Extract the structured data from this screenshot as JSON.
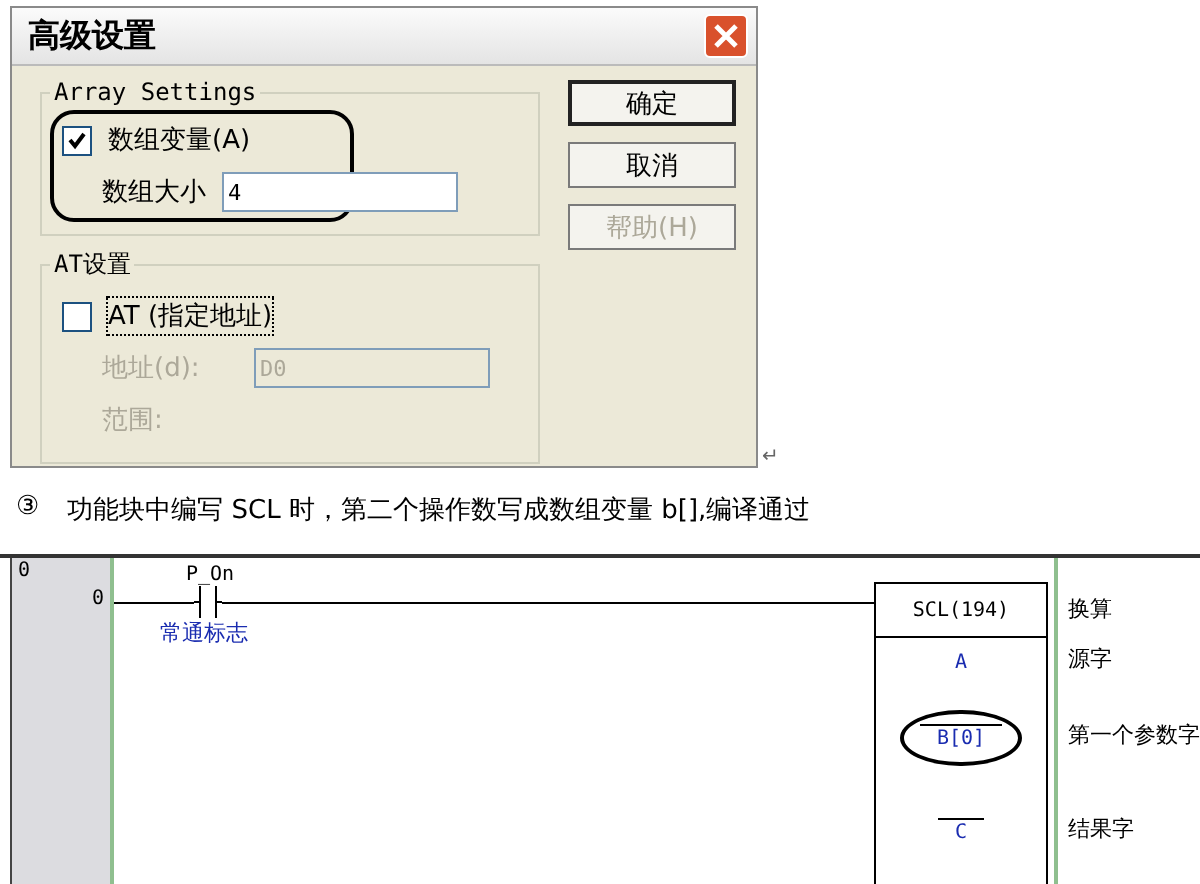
{
  "dialog": {
    "title": "高级设置",
    "groups": [
      {
        "title": "Array Settings",
        "circled": true,
        "rows": [
          {
            "kind": "checkbox",
            "label": "数组变量(A)",
            "checked": true,
            "disabled": false,
            "focused": false
          },
          {
            "kind": "field",
            "label": "数组大小",
            "value": "4",
            "disabled": false
          }
        ]
      },
      {
        "title": "AT设置",
        "circled": false,
        "rows": [
          {
            "kind": "checkbox",
            "label": "AT (指定地址)",
            "checked": false,
            "disabled": false,
            "focused": true
          },
          {
            "kind": "field",
            "label": "地址(d):",
            "value": "D0",
            "disabled": true
          },
          {
            "kind": "label",
            "label": "范围:",
            "disabled": true
          }
        ]
      }
    ],
    "buttons": [
      {
        "label": "确定",
        "disabled": false,
        "default": true
      },
      {
        "label": "取消",
        "disabled": false,
        "default": false
      },
      {
        "label": "帮助(H)",
        "disabled": true,
        "default": false
      }
    ]
  },
  "paragraph_mark": "↵",
  "caption": {
    "number": "③",
    "text": "功能块中编写 SCL 时，第二个操作数写成数组变量 b[],编译通过"
  },
  "ladder": {
    "rung": "0",
    "step": "0",
    "contact": {
      "name": "P_On",
      "comment": "常通标志"
    },
    "block": {
      "instruction": "SCL(194)",
      "comment": "换算",
      "operands": [
        {
          "value": "A",
          "comment": "源字",
          "overline": false,
          "circled": false
        },
        {
          "value": "B[0]",
          "comment": "第一个参数字",
          "overline": true,
          "circled": true
        },
        {
          "value": "C",
          "comment": "结果字",
          "overline": true,
          "circled": false
        }
      ]
    }
  }
}
